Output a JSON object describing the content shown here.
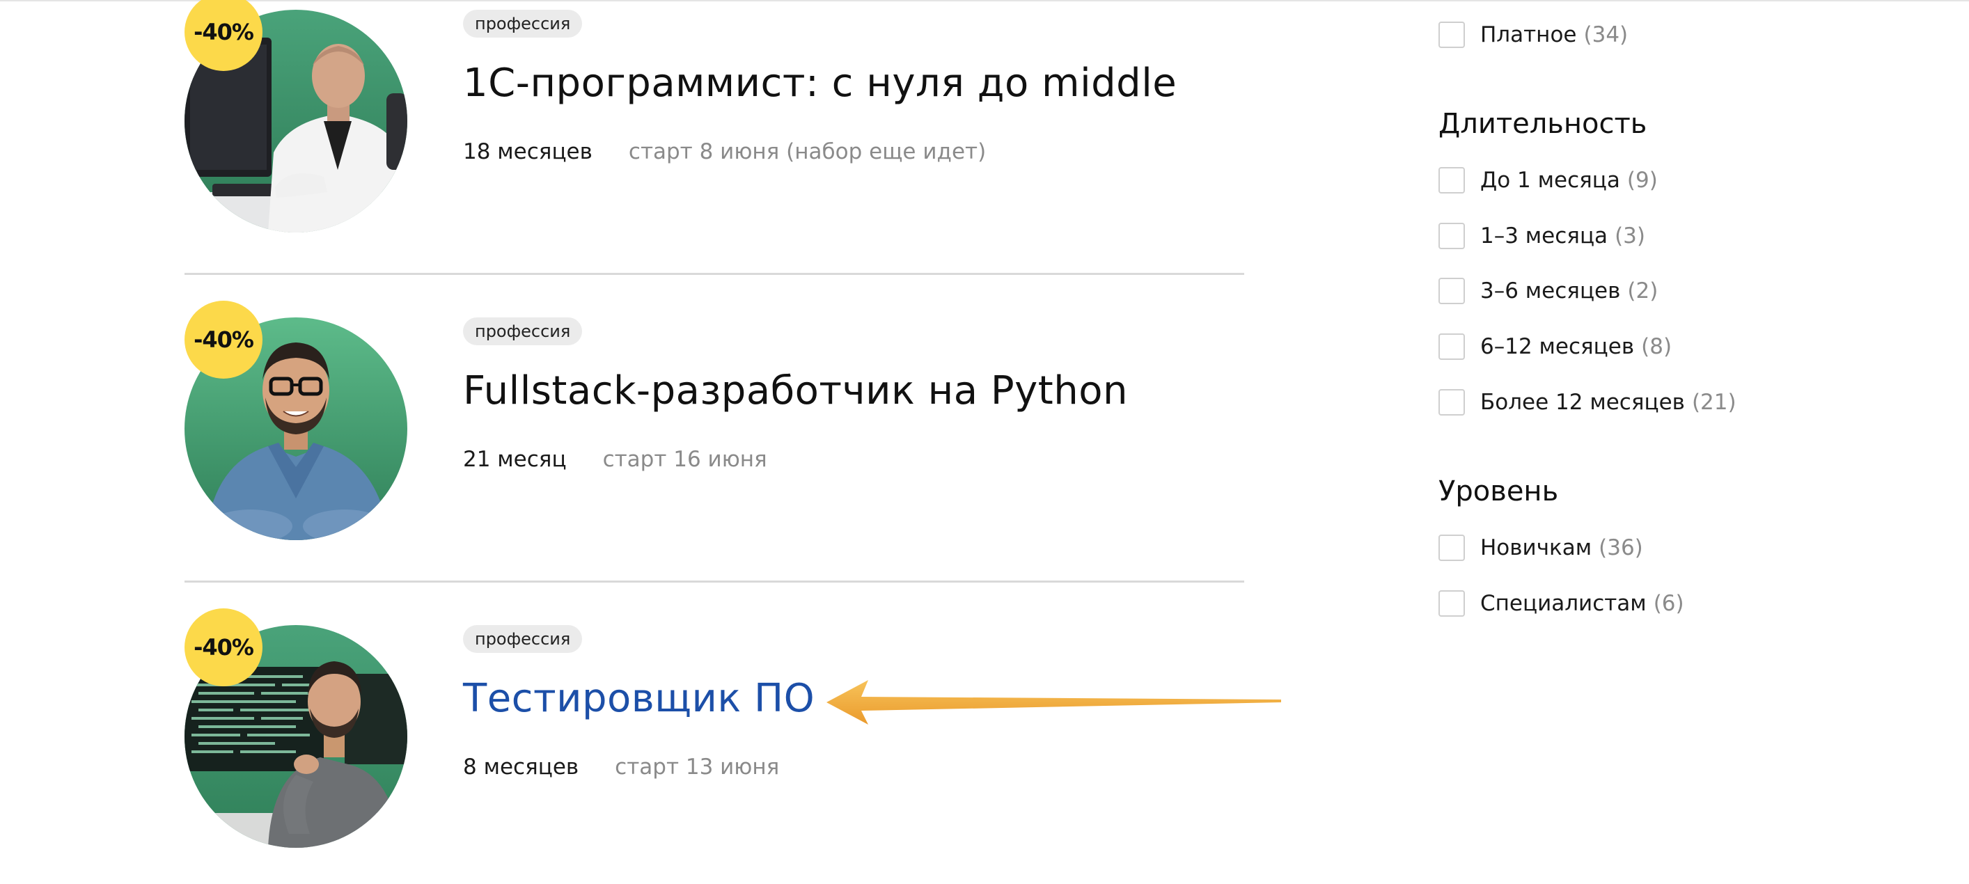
{
  "courses": [
    {
      "discount": "-40%",
      "tag": "профессия",
      "title": "1С-программист: с нуля до middle",
      "duration": "18 месяцев",
      "start": "старт 8 июня (набор еще идет)"
    },
    {
      "discount": "-40%",
      "tag": "профессия",
      "title": "Fullstack-разработчик на Python",
      "duration": "21 месяц",
      "start": "старт 16 июня"
    },
    {
      "discount": "-40%",
      "tag": "профессия",
      "title": "Тестировщик ПО",
      "duration": "8 месяцев",
      "start": "старт 13 июня"
    }
  ],
  "filters": {
    "price": {
      "items": [
        {
          "label": "Платное",
          "count": "(34)"
        }
      ]
    },
    "duration": {
      "heading": "Длительность",
      "items": [
        {
          "label": "До 1 месяца",
          "count": "(9)"
        },
        {
          "label": "1–3 месяца",
          "count": "(3)"
        },
        {
          "label": "3–6 месяцев",
          "count": "(2)"
        },
        {
          "label": "6–12 месяцев",
          "count": "(8)"
        },
        {
          "label": "Более 12 месяцев",
          "count": "(21)"
        }
      ]
    },
    "level": {
      "heading": "Уровень",
      "items": [
        {
          "label": "Новичкам",
          "count": "(36)"
        },
        {
          "label": "Специалистам",
          "count": "(6)"
        }
      ]
    }
  },
  "colors": {
    "badge": "#fcd94a",
    "active_title": "#1c4fa8",
    "arrow": "#f2a93b",
    "avatar_green": "#3d9a6b"
  }
}
